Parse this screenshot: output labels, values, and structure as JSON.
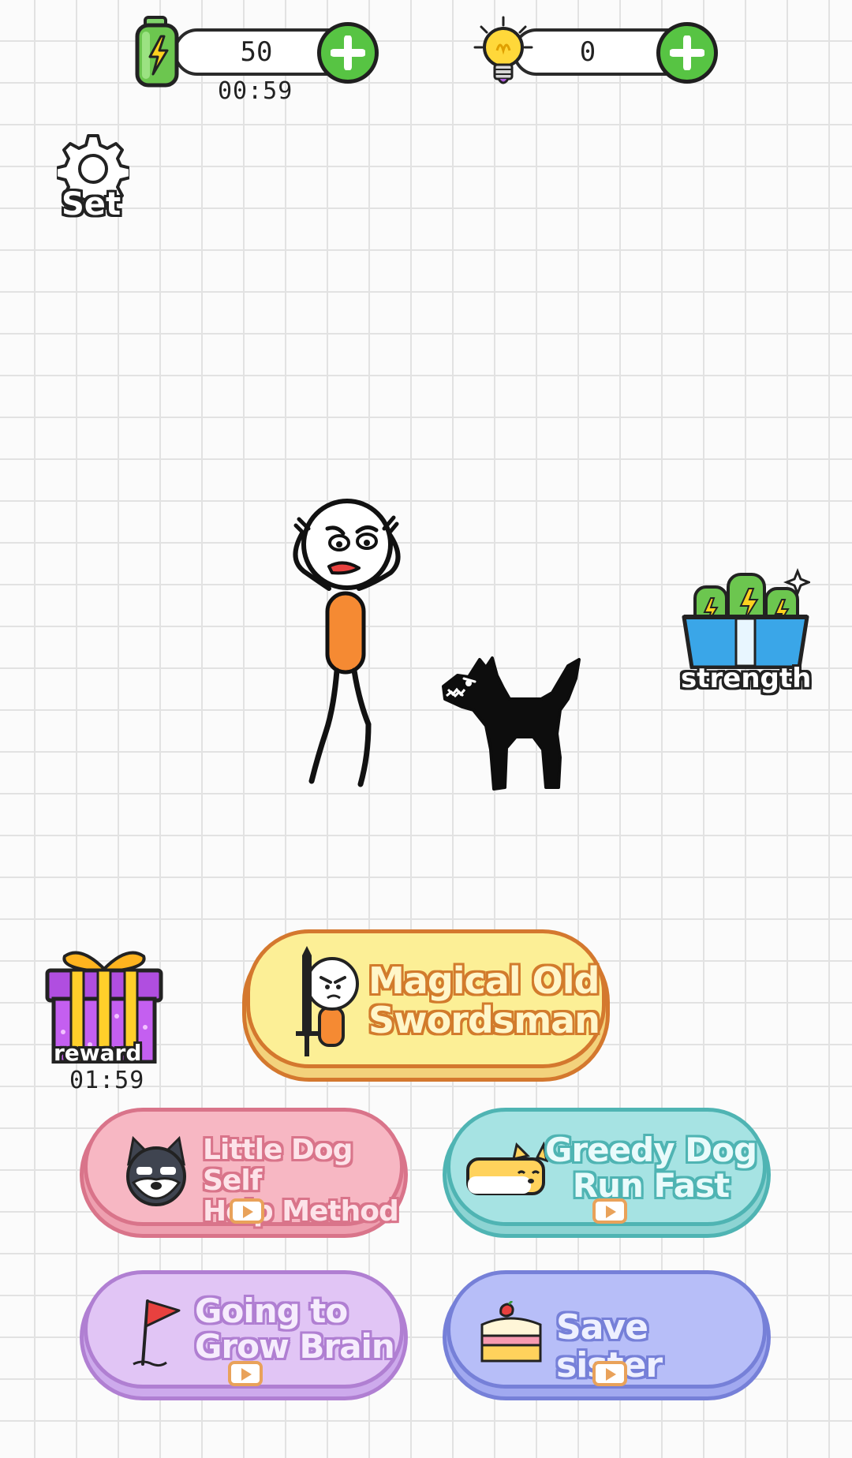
{
  "hud": {
    "energy": {
      "value": "50",
      "timer": "00:59"
    },
    "hints": {
      "value": "0"
    }
  },
  "settings": {
    "label": "Set"
  },
  "strength": {
    "label": "strength"
  },
  "reward": {
    "label": "reward",
    "timer": "01:59"
  },
  "levels": {
    "featured": {
      "title_line1": "Magical Old",
      "title_line2": "Swordsman"
    },
    "dog_self_help": {
      "title_line1": "Little Dog Self",
      "title_line2": "Help Method"
    },
    "greedy_dog": {
      "title_line1": "Greedy Dog",
      "title_line2": "Run Fast"
    },
    "grow_brain": {
      "title_line1": "Going to",
      "title_line2": "Grow Brain"
    },
    "save_sister": {
      "title_line1": "Save sister"
    }
  },
  "colors": {
    "featured_fill": "#fcef96",
    "featured_border": "#d4782e",
    "pink_fill": "#f7b7c3",
    "pink_border": "#d9748a",
    "teal_fill": "#a6e3e3",
    "teal_border": "#4fb4b3",
    "lilac_fill": "#e1c5f5",
    "lilac_border": "#b07fd2",
    "blue_fill": "#b7bef8",
    "blue_border": "#7680d8"
  }
}
